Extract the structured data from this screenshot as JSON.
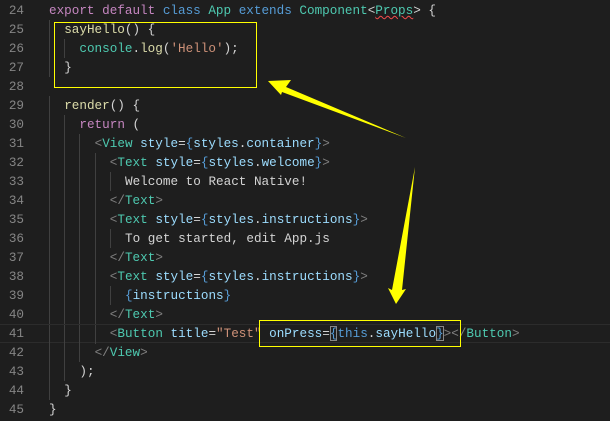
{
  "editor": {
    "lines": [
      {
        "n": "24",
        "indent": 0,
        "tokens": [
          [
            "kw",
            "export"
          ],
          [
            "tx",
            " "
          ],
          [
            "kw",
            "default"
          ],
          [
            "tx",
            " "
          ],
          [
            "st",
            "class"
          ],
          [
            "tx",
            " "
          ],
          [
            "ty",
            "App"
          ],
          [
            "tx",
            " "
          ],
          [
            "st",
            "extends"
          ],
          [
            "tx",
            " "
          ],
          [
            "ty",
            "Component"
          ],
          [
            "tx",
            "<"
          ],
          [
            "ty squig",
            "Props"
          ],
          [
            "tx",
            "> {"
          ]
        ]
      },
      {
        "n": "25",
        "indent": 2,
        "tokens": [
          [
            "fn",
            "sayHello"
          ],
          [
            "tx",
            "() {"
          ]
        ]
      },
      {
        "n": "26",
        "indent": 4,
        "tokens": [
          [
            "ty",
            "console"
          ],
          [
            "tx",
            "."
          ],
          [
            "fn",
            "log"
          ],
          [
            "tx",
            "("
          ],
          [
            "str",
            "'Hello'"
          ],
          [
            "tx",
            ");"
          ]
        ]
      },
      {
        "n": "27",
        "indent": 2,
        "tokens": [
          [
            "tx",
            "}"
          ]
        ]
      },
      {
        "n": "28",
        "indent": 0,
        "tokens": []
      },
      {
        "n": "29",
        "indent": 2,
        "tokens": [
          [
            "fn",
            "render"
          ],
          [
            "tx",
            "() {"
          ]
        ]
      },
      {
        "n": "30",
        "indent": 4,
        "tokens": [
          [
            "kw",
            "return"
          ],
          [
            "tx",
            " ("
          ]
        ]
      },
      {
        "n": "31",
        "indent": 6,
        "tokens": [
          [
            "br",
            "<"
          ],
          [
            "ty",
            "View"
          ],
          [
            "tx",
            " "
          ],
          [
            "va",
            "style"
          ],
          [
            "tx",
            "="
          ],
          [
            "st",
            "{"
          ],
          [
            "va",
            "styles"
          ],
          [
            "tx",
            "."
          ],
          [
            "va",
            "container"
          ],
          [
            "st",
            "}"
          ],
          [
            "br",
            ">"
          ]
        ]
      },
      {
        "n": "32",
        "indent": 8,
        "tokens": [
          [
            "br",
            "<"
          ],
          [
            "ty",
            "Text"
          ],
          [
            "tx",
            " "
          ],
          [
            "va",
            "style"
          ],
          [
            "tx",
            "="
          ],
          [
            "st",
            "{"
          ],
          [
            "va",
            "styles"
          ],
          [
            "tx",
            "."
          ],
          [
            "va",
            "welcome"
          ],
          [
            "st",
            "}"
          ],
          [
            "br",
            ">"
          ]
        ]
      },
      {
        "n": "33",
        "indent": 10,
        "tokens": [
          [
            "tx",
            "Welcome to React Native!"
          ]
        ]
      },
      {
        "n": "34",
        "indent": 8,
        "tokens": [
          [
            "br",
            "</"
          ],
          [
            "ty",
            "Text"
          ],
          [
            "br",
            ">"
          ]
        ]
      },
      {
        "n": "35",
        "indent": 8,
        "tokens": [
          [
            "br",
            "<"
          ],
          [
            "ty",
            "Text"
          ],
          [
            "tx",
            " "
          ],
          [
            "va",
            "style"
          ],
          [
            "tx",
            "="
          ],
          [
            "st",
            "{"
          ],
          [
            "va",
            "styles"
          ],
          [
            "tx",
            "."
          ],
          [
            "va",
            "instructions"
          ],
          [
            "st",
            "}"
          ],
          [
            "br",
            ">"
          ]
        ]
      },
      {
        "n": "36",
        "indent": 10,
        "tokens": [
          [
            "tx",
            "To get started, edit App.js"
          ]
        ]
      },
      {
        "n": "37",
        "indent": 8,
        "tokens": [
          [
            "br",
            "</"
          ],
          [
            "ty",
            "Text"
          ],
          [
            "br",
            ">"
          ]
        ]
      },
      {
        "n": "38",
        "indent": 8,
        "tokens": [
          [
            "br",
            "<"
          ],
          [
            "ty",
            "Text"
          ],
          [
            "tx",
            " "
          ],
          [
            "va",
            "style"
          ],
          [
            "tx",
            "="
          ],
          [
            "st",
            "{"
          ],
          [
            "va",
            "styles"
          ],
          [
            "tx",
            "."
          ],
          [
            "va",
            "instructions"
          ],
          [
            "st",
            "}"
          ],
          [
            "br",
            ">"
          ]
        ]
      },
      {
        "n": "39",
        "indent": 10,
        "tokens": [
          [
            "st",
            "{"
          ],
          [
            "va",
            "instructions"
          ],
          [
            "st",
            "}"
          ]
        ]
      },
      {
        "n": "40",
        "indent": 8,
        "tokens": [
          [
            "br",
            "</"
          ],
          [
            "ty",
            "Text"
          ],
          [
            "br",
            ">"
          ]
        ]
      },
      {
        "n": "41",
        "indent": 8,
        "current": true,
        "tokens": [
          [
            "br",
            "<"
          ],
          [
            "ty",
            "Button"
          ],
          [
            "tx",
            " "
          ],
          [
            "va",
            "title"
          ],
          [
            "tx",
            "="
          ],
          [
            "str",
            "\"Test\""
          ],
          [
            "tx",
            " "
          ],
          [
            "va",
            "onPress"
          ],
          [
            "tx",
            "="
          ],
          [
            "st match",
            "{"
          ],
          [
            "st",
            "this"
          ],
          [
            "tx",
            "."
          ],
          [
            "va",
            "sayHello"
          ],
          [
            "st match",
            "}"
          ],
          [
            "br",
            "></"
          ],
          [
            "ty",
            "Button"
          ],
          [
            "br",
            ">"
          ]
        ]
      },
      {
        "n": "42",
        "indent": 6,
        "tokens": [
          [
            "br",
            "</"
          ],
          [
            "ty",
            "View"
          ],
          [
            "br",
            ">"
          ]
        ]
      },
      {
        "n": "43",
        "indent": 4,
        "tokens": [
          [
            "tx",
            ");"
          ]
        ]
      },
      {
        "n": "44",
        "indent": 2,
        "tokens": [
          [
            "tx",
            "}"
          ]
        ]
      },
      {
        "n": "45",
        "indent": 0,
        "tokens": [
          [
            "tx",
            "}"
          ]
        ]
      }
    ]
  },
  "annotation_color": "#ffff00"
}
